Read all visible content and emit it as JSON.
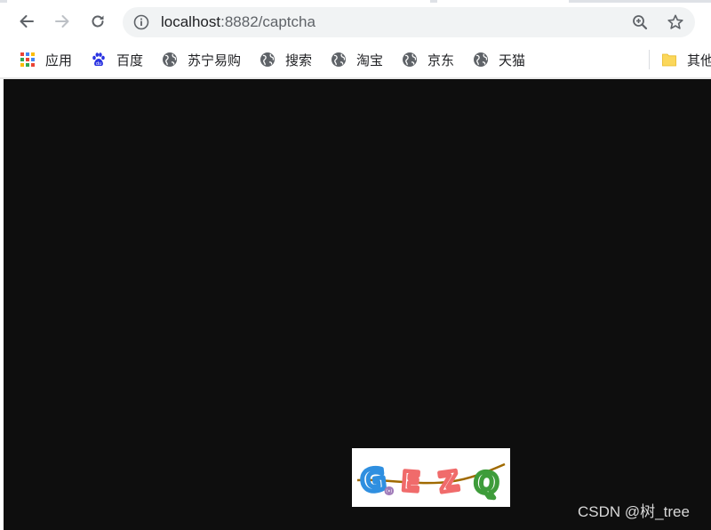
{
  "browser": {
    "address_bar": {
      "host": "localhost",
      "path": ":8882/captcha"
    },
    "bookmarks": [
      {
        "label": "应用",
        "icon": "apps-grid-icon"
      },
      {
        "label": "百度",
        "icon": "baidu-paw-icon"
      },
      {
        "label": "苏宁易购",
        "icon": "globe-icon"
      },
      {
        "label": "搜索",
        "icon": "globe-icon"
      },
      {
        "label": "淘宝",
        "icon": "globe-icon"
      },
      {
        "label": "京东",
        "icon": "globe-icon"
      },
      {
        "label": "天猫",
        "icon": "globe-icon"
      }
    ],
    "other_bookmarks": {
      "label": "其他",
      "icon": "folder-icon"
    }
  },
  "page": {
    "background": "#0e0e0e",
    "captcha": {
      "characters": [
        "G",
        "o",
        "E",
        "Z",
        "Q"
      ],
      "colors": [
        "#2f8fe0",
        "#a07ab8",
        "#f06b6b",
        "#f06b6b",
        "#3e9c3a"
      ],
      "noise_line_color": "#a06a00"
    }
  },
  "watermark": {
    "text": "CSDN @树_tree"
  }
}
